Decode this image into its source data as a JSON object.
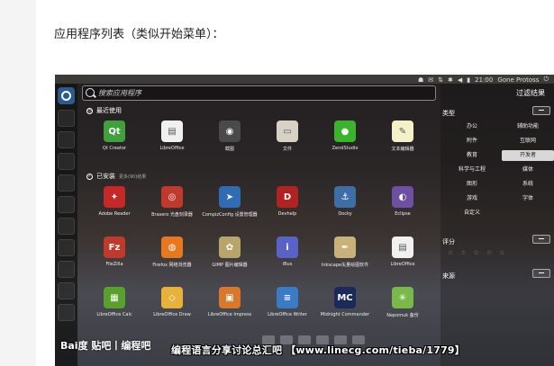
{
  "page": {
    "heading": "应用程序列表（类似开始菜单）："
  },
  "topbar": {
    "time": "21:00",
    "user": "Gone Protoss",
    "icons": [
      "ghost-icon",
      "mail-icon",
      "network-icon",
      "bluetooth-icon",
      "volume-icon",
      "battery-icon",
      "power-icon"
    ]
  },
  "search": {
    "placeholder": "搜索应用程序"
  },
  "sections": {
    "recent": "最近使用",
    "installed": "已安装",
    "installed_more": "更多(90)结果"
  },
  "recent_apps": [
    {
      "name": "Qt Creator",
      "icon": "qt-icon",
      "color": "#41a03c"
    },
    {
      "name": "LibreOffice",
      "icon": "document-icon",
      "color": "#f0f0f0"
    },
    {
      "name": "截图",
      "icon": "camera-icon",
      "color": "#4a4a4a"
    },
    {
      "name": "文件",
      "icon": "folder-icon",
      "color": "#d8d2c4"
    },
    {
      "name": "ZendStudio",
      "icon": "zend-icon",
      "color": "#3cb32d"
    },
    {
      "name": "文本编辑器",
      "icon": "text-editor-icon",
      "color": "#f4f0c8"
    }
  ],
  "installed_apps": [
    {
      "name": "Adobe Reader",
      "icon": "pdf-icon",
      "color": "#c62828"
    },
    {
      "name": "Brasero 光盘刻录器",
      "icon": "disc-icon",
      "color": "#c0392b"
    },
    {
      "name": "CompizConfig 设置管理器",
      "icon": "cursor-icon",
      "color": "#2f6cb5"
    },
    {
      "name": "Devhelp",
      "icon": "book-icon",
      "color": "#b22222"
    },
    {
      "name": "Docky",
      "icon": "anchor-icon",
      "color": "#3d6ea8"
    },
    {
      "name": "Eclipse",
      "icon": "eclipse-icon",
      "color": "#6f4fa3"
    },
    {
      "name": "FileZilla",
      "icon": "filezilla-icon",
      "color": "#c0392b"
    },
    {
      "name": "Firefox 网络浏览器",
      "icon": "firefox-icon",
      "color": "#e8781e"
    },
    {
      "name": "GIMP 图片编辑器",
      "icon": "gimp-icon",
      "color": "#b8a56a"
    },
    {
      "name": "iBus",
      "icon": "info-icon",
      "color": "#5963c7"
    },
    {
      "name": "Inkscape矢量绘图软件",
      "icon": "inkscape-icon",
      "color": "#c8b27a"
    },
    {
      "name": "LibreOffice",
      "icon": "document-icon",
      "color": "#f0f0f0"
    },
    {
      "name": "LibreOffice Calc",
      "icon": "calc-icon",
      "color": "#5aa02c"
    },
    {
      "name": "LibreOffice Draw",
      "icon": "draw-icon",
      "color": "#e8b23a"
    },
    {
      "name": "LibreOffice Impress",
      "icon": "impress-icon",
      "color": "#d9772a"
    },
    {
      "name": "LibreOffice Writer",
      "icon": "writer-icon",
      "color": "#3a7bc8"
    },
    {
      "name": "Midnight Commander",
      "icon": "mc-icon",
      "color": "#1b2a5a"
    },
    {
      "name": "Nepomuk 备份",
      "icon": "nepomuk-icon",
      "color": "#7ab84a"
    }
  ],
  "filter": {
    "title": "过滤结果",
    "type_label": "类型",
    "categories": [
      "办公",
      "辅助功能",
      "附件",
      "互联网",
      "教育",
      "开发者",
      "科学与工程",
      "媒体",
      "图形",
      "系统",
      "游戏",
      "字体",
      "自定义"
    ],
    "selected": "开发者",
    "rating_label": "评分",
    "source_label": "来源"
  },
  "watermark": {
    "baidu": "Bai度 贴吧丨编程吧",
    "forum": "编程语言分享讨论总汇吧 【www.linecg.com/tieba/1779】"
  }
}
